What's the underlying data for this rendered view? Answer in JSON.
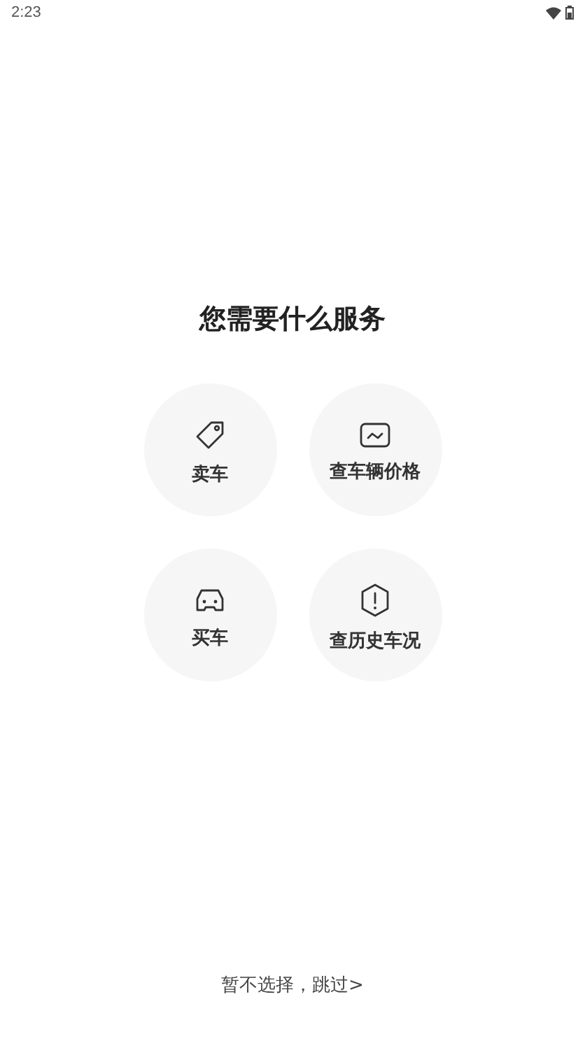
{
  "status_bar": {
    "time": "2:23"
  },
  "title": "您需要什么服务",
  "options": [
    {
      "label": "卖车"
    },
    {
      "label": "查车辆价格"
    },
    {
      "label": "买车"
    },
    {
      "label": "查历史车况"
    }
  ],
  "skip_link": "暂不选择，跳过>"
}
